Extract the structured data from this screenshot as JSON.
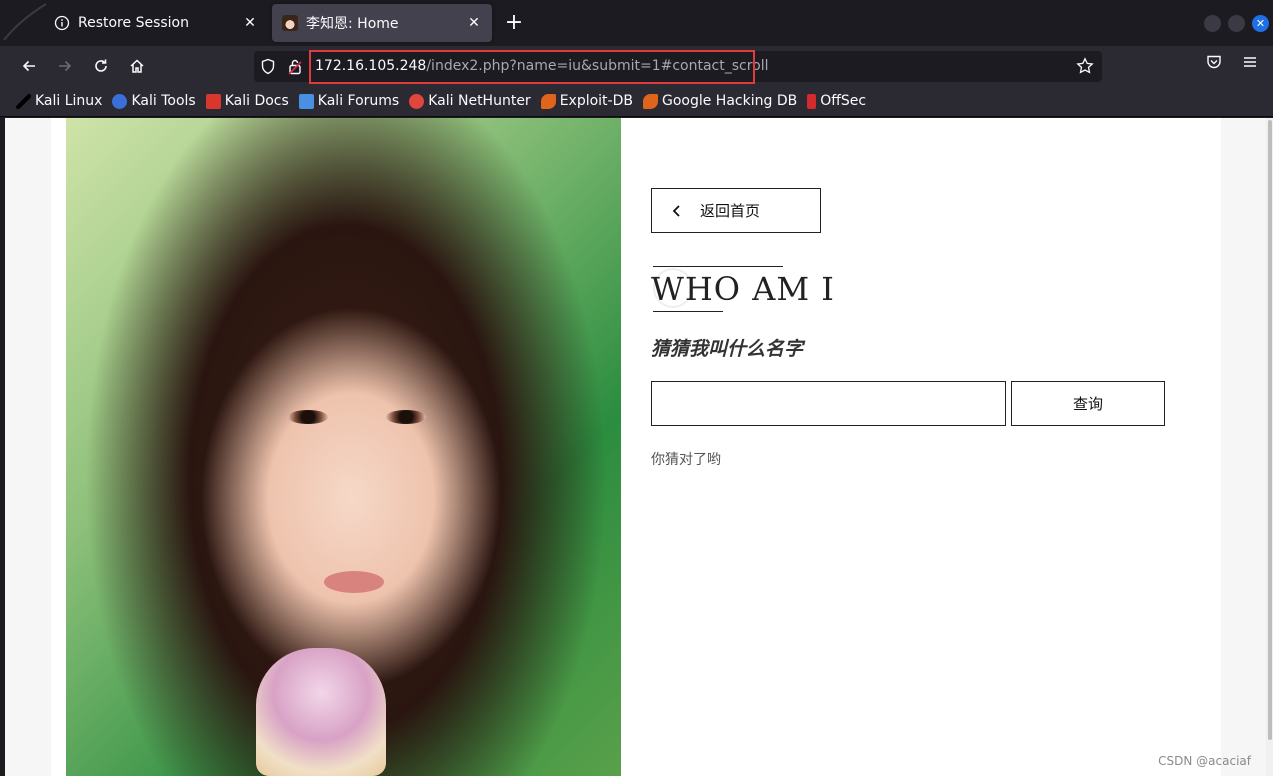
{
  "browser": {
    "tabs": [
      {
        "title": "Restore Session",
        "icon": "info-icon",
        "active": false
      },
      {
        "title": "李知恩: Home",
        "icon": "avatar-favicon",
        "active": true
      }
    ],
    "url": {
      "host": "172.16.105.248",
      "path": "/index2.php?name=iu&submit=1#contact_scroll"
    },
    "bookmarks": [
      {
        "label": "Kali Linux",
        "icon": "kali-dragon-icon",
        "color": "#000000"
      },
      {
        "label": "Kali Tools",
        "icon": "kali-tools-icon",
        "color": "#3a6fd8"
      },
      {
        "label": "Kali Docs",
        "icon": "kali-docs-icon",
        "color": "#d9372c"
      },
      {
        "label": "Kali Forums",
        "icon": "kali-forums-icon",
        "color": "#4a90e2"
      },
      {
        "label": "Kali NetHunter",
        "icon": "nethunter-icon",
        "color": "#e0463b"
      },
      {
        "label": "Exploit-DB",
        "icon": "exploit-db-icon",
        "color": "#e0651c"
      },
      {
        "label": "Google Hacking DB",
        "icon": "ghdb-icon",
        "color": "#e0651c"
      },
      {
        "label": "OffSec",
        "icon": "offsec-icon",
        "color": "#d22b2b"
      }
    ]
  },
  "page": {
    "back_label": "返回首页",
    "title": "WHO AM I",
    "subtitle": "猜猜我叫什么名字",
    "input_value": "",
    "query_label": "查询",
    "result_text": "你猜对了哟"
  },
  "watermark": "CSDN @acaciaf"
}
